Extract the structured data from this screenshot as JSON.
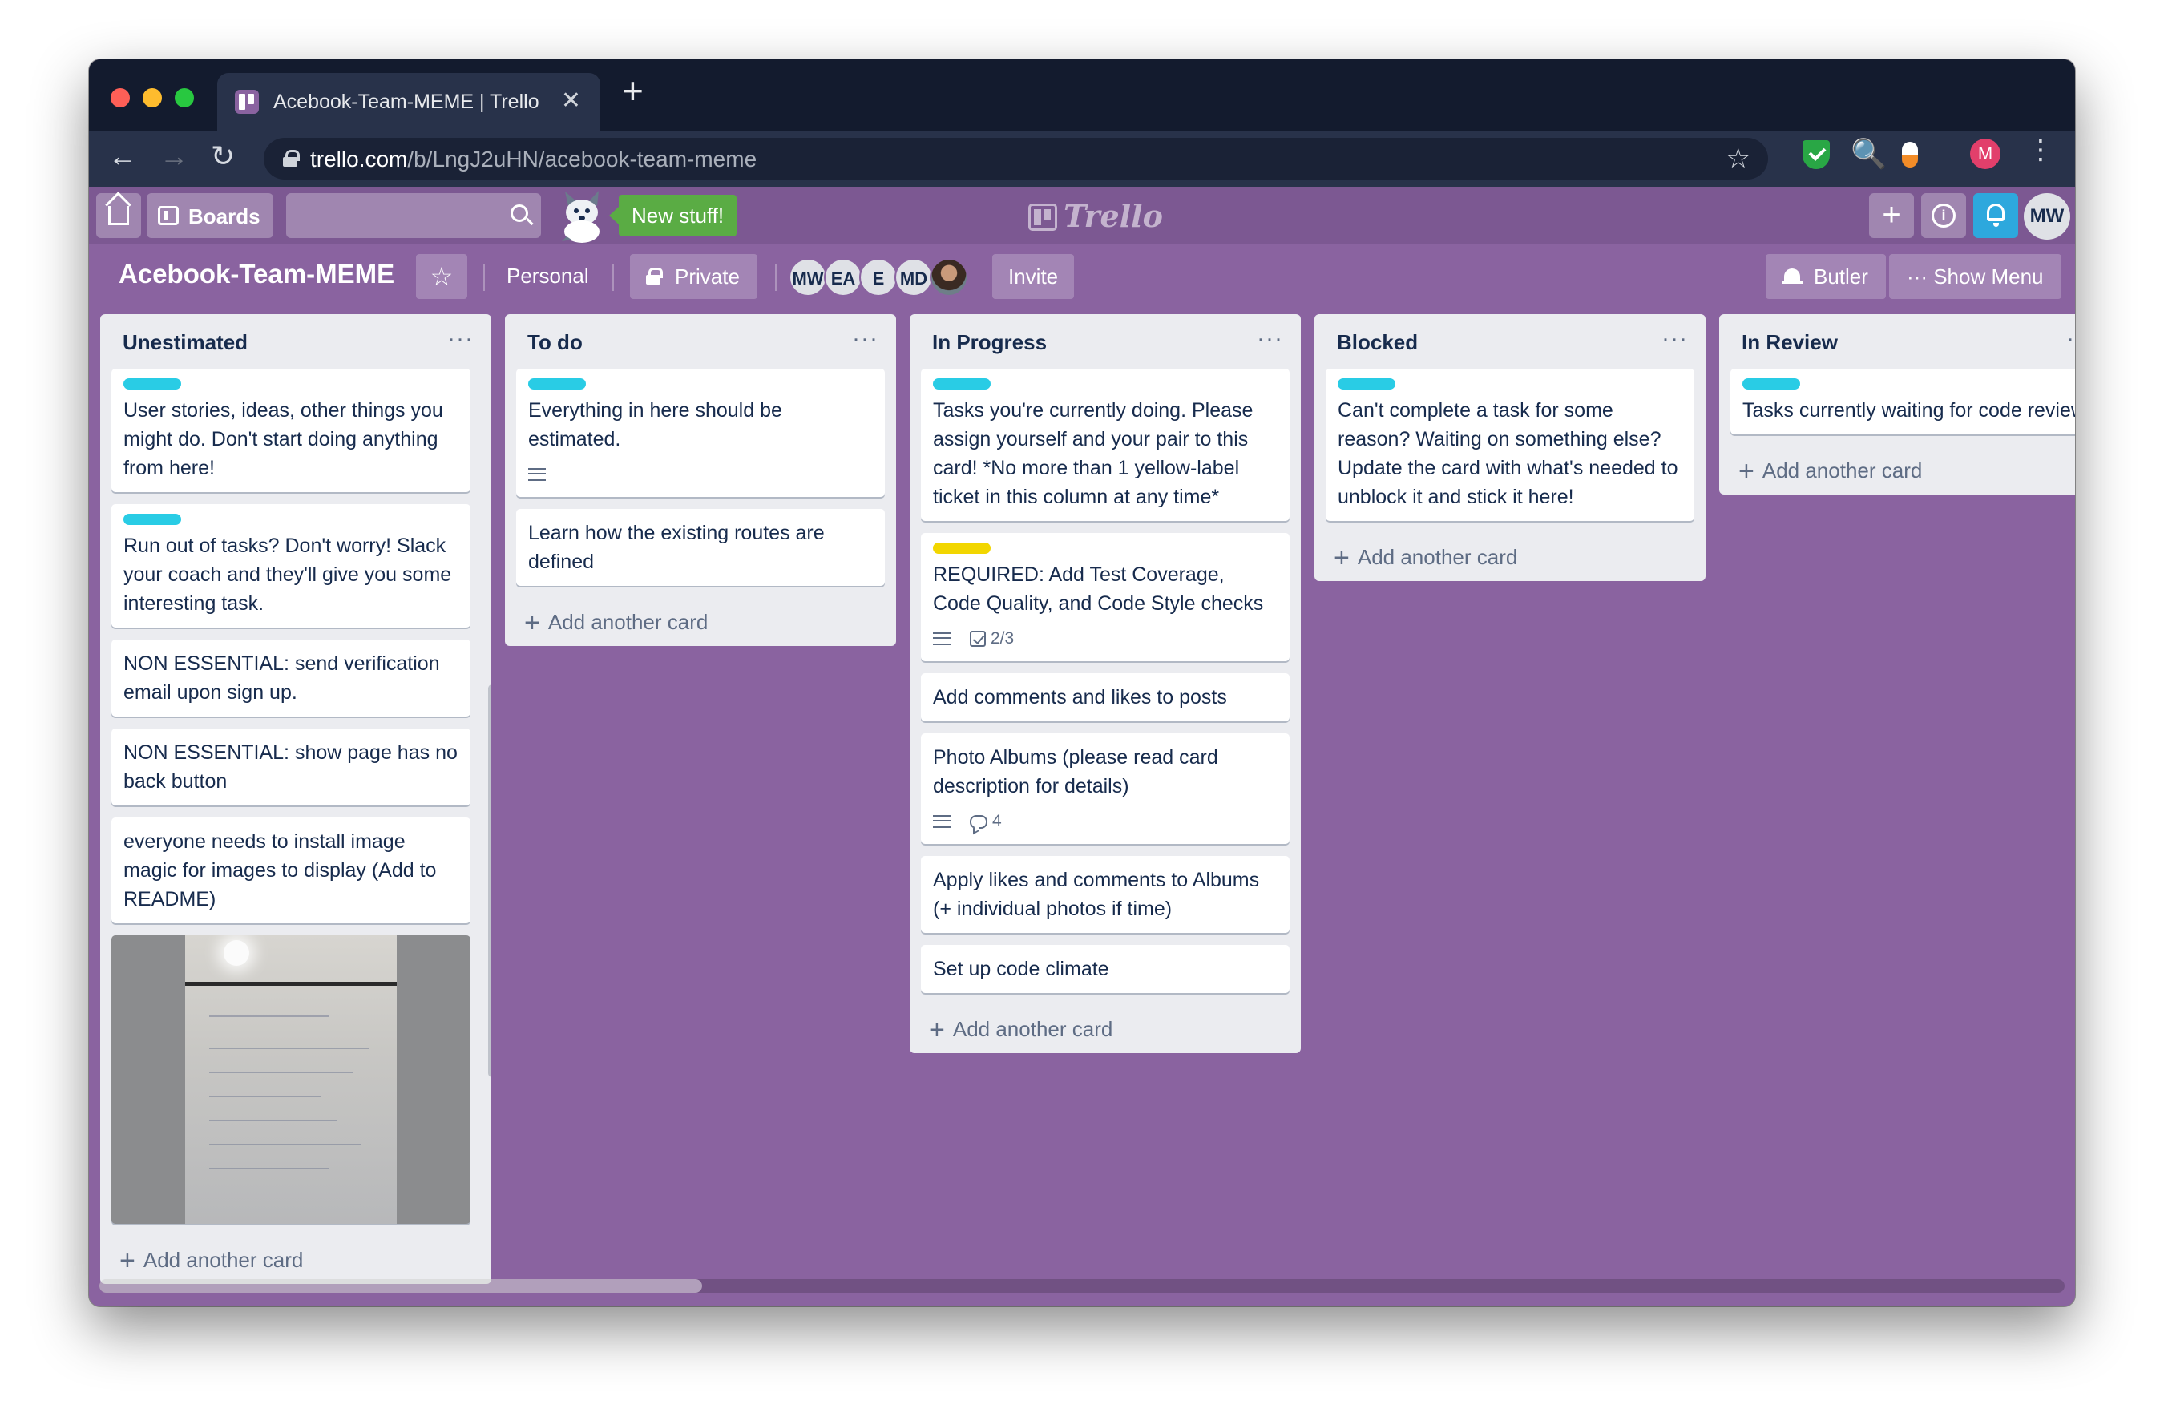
{
  "browser": {
    "tab_title": "Acebook-Team-MEME | Trello",
    "tab_close": "✕",
    "new_tab": "+",
    "url_host": "trello.com",
    "url_path": "/b/LngJ2uHN/acebook-team-meme",
    "back": "←",
    "forward": "→",
    "reload": "↻",
    "bookmark_star": "☆",
    "search_ext": "🔍",
    "profile_initial": "M",
    "menu": "⋮"
  },
  "header": {
    "boards_label": "Boards",
    "new_stuff": "New stuff!",
    "logo_text": "Trello",
    "add": "+",
    "info": "i",
    "user_initials": "MW"
  },
  "board": {
    "title": "Acebook-Team-MEME",
    "star": "☆",
    "visibility_team": "Personal",
    "privacy": "Private",
    "members": [
      "MW",
      "EA",
      "E",
      "MD"
    ],
    "invite": "Invite",
    "butler": "Butler",
    "show_menu": "··· Show Menu"
  },
  "lists": [
    {
      "title": "Unestimated",
      "menu": "···",
      "add_card": "Add another card",
      "cards": [
        {
          "label_color": "#29cce5",
          "text": "User stories, ideas, other things you might do. Don't start doing anything from here!"
        },
        {
          "label_color": "#29cce5",
          "text": "Run out of tasks? Don't worry! Slack your coach and they'll give you some interesting task."
        },
        {
          "text": "NON ESSENTIAL: send verification email upon sign up."
        },
        {
          "text": "NON ESSENTIAL: show page has no back button"
        },
        {
          "text": "everyone needs to install image magic for images to display (Add to README)"
        }
      ]
    },
    {
      "title": "To do",
      "menu": "···",
      "add_card": "Add another card",
      "cards": [
        {
          "label_color": "#29cce5",
          "text": "Everything in here should be estimated.",
          "has_description": true
        },
        {
          "text": "Learn how the existing routes are defined"
        }
      ]
    },
    {
      "title": "In Progress",
      "menu": "···",
      "add_card": "Add another card",
      "cards": [
        {
          "label_color": "#29cce5",
          "text": "Tasks you're currently doing. Please assign yourself and your pair to this card! *No more than 1 yellow-label ticket in this column at any time*"
        },
        {
          "label_color": "#f2d600",
          "text": "REQUIRED: Add Test Coverage, Code Quality, and Code Style checks",
          "has_description": true,
          "checklist": "2/3"
        },
        {
          "text": "Add comments and likes to posts"
        },
        {
          "text": "Photo Albums (please read card description for details)",
          "has_description": true,
          "comments": "4"
        },
        {
          "text": "Apply likes and comments to Albums (+ individual photos if time)"
        },
        {
          "text": "Set up code climate"
        }
      ]
    },
    {
      "title": "Blocked",
      "menu": "···",
      "add_card": "Add another card",
      "cards": [
        {
          "label_color": "#29cce5",
          "text": "Can't complete a task for some reason? Waiting on something else? Update the card with what's needed to unblock it and stick it here!"
        }
      ]
    },
    {
      "title": "In Review",
      "menu": "···",
      "add_card": "Add another card",
      "cards": [
        {
          "label_color": "#29cce5",
          "text": "Tasks currently waiting for code review"
        }
      ]
    }
  ]
}
